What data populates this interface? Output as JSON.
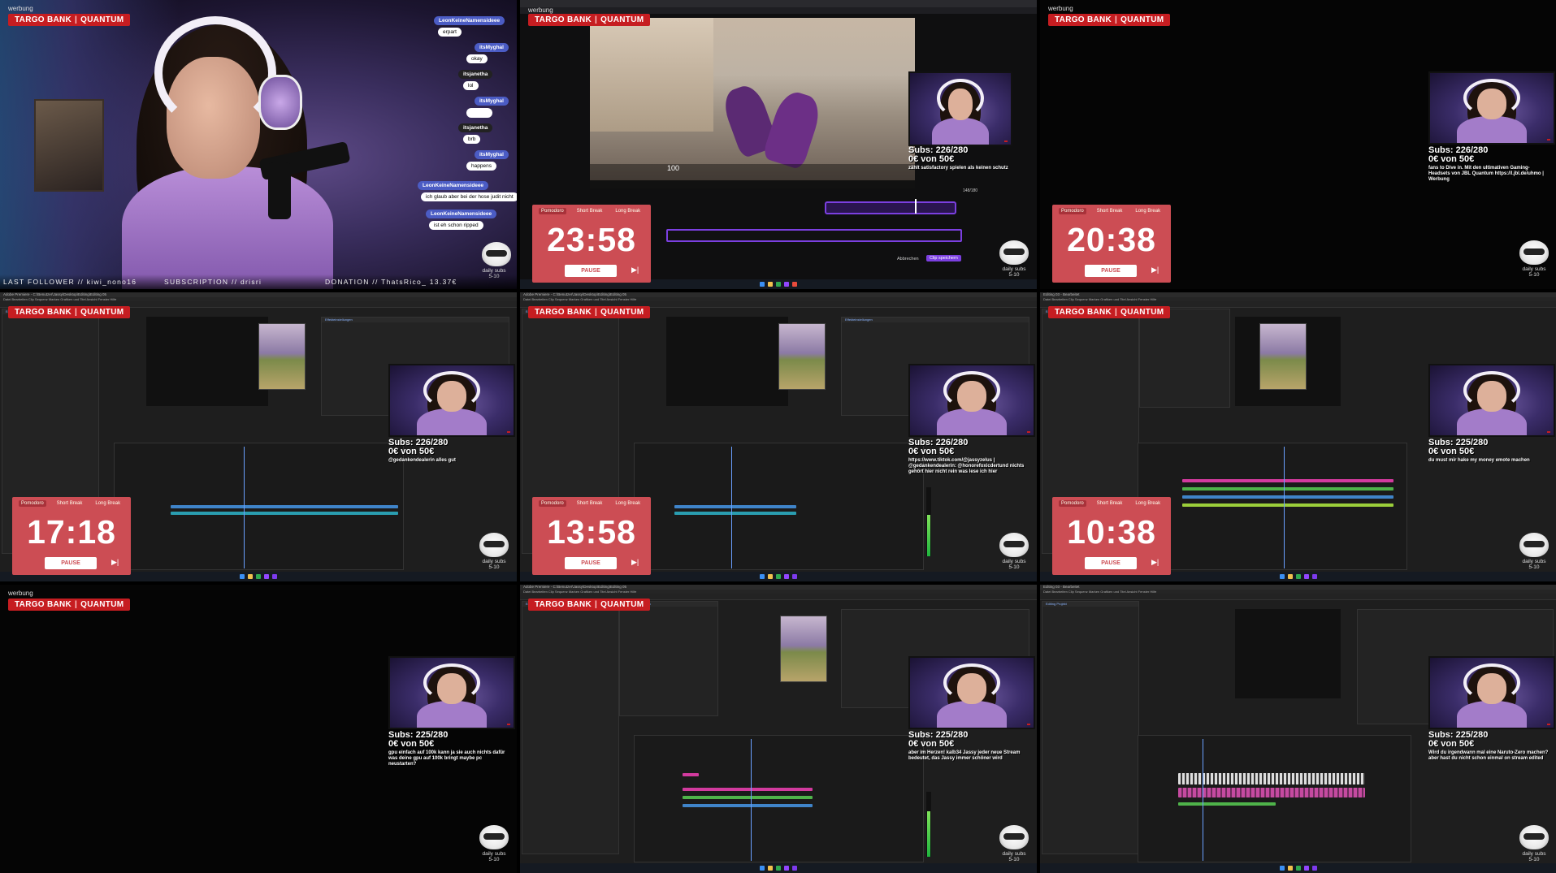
{
  "sponsor": {
    "werbung": "werbung",
    "brand_left": "TARGO BANK",
    "brand_right": "QUANTUM"
  },
  "top_left": {
    "chat": [
      {
        "name": "LeonKeineNamensideee",
        "msg": "erpart"
      },
      {
        "name": "itsMyghal",
        "msg": "okay"
      },
      {
        "name": "itsjanetha",
        "msg": "lol"
      },
      {
        "name": "itsMyghal",
        "msg": ""
      },
      {
        "name": "itsjanetha",
        "msg": "brb"
      },
      {
        "name": "itsMyghal",
        "msg": "happens"
      },
      {
        "name": "LeonKeineNamensideee",
        "msg": "ich glaub aber bei der hose judit nicht"
      },
      {
        "name": "LeonKeineNamensideee",
        "msg": "ist eh schon ripped"
      }
    ],
    "last_follower": "LAST FOLLOWER // kiwi_nono16",
    "subscription": "SUBSCRIPTION // drisri",
    "donation": "DONATION // ThatsRico_ 13.37€"
  },
  "cells": [
    {
      "time": "23:58",
      "subs": "Subs: 226/280",
      "money": "0€ von 50€",
      "chat": "zählt satisfactory spielen als keinen schutz"
    },
    {
      "time": "20:38",
      "subs": "Subs: 226/280",
      "money": "0€ von 50€",
      "chat": "fans to Dive in. Mit den ultimativen Gaming-Headsets von JBL Quantum https://l.jbl.de/uhmo | Werbung"
    },
    {
      "time": "17:18",
      "subs": "Subs: 226/280",
      "money": "0€ von 50€",
      "chat": "@gedankendealerin alles gut"
    },
    {
      "time": "13:58",
      "subs": "Subs: 226/280",
      "money": "0€ von 50€",
      "chat": "https://www.tiktok.com/@jassyzelus | @gedankendealerin: @honorefoxicdertund nichts gehört hier nicht rein was lese ich hier"
    },
    {
      "time": "10:38",
      "subs": "Subs: 225/280",
      "money": "0€ von 50€",
      "chat": "du must mir hake my money emote machen"
    },
    {
      "time": "",
      "subs": "Subs: 225/280",
      "money": "0€ von 50€",
      "chat": "gpu einfach auf 100k kann ja sie auch nichts dafür was deine gpu auf 100k bringt maybe pc neustarten?"
    },
    {
      "time": "",
      "subs": "Subs: 225/280",
      "money": "0€ von 50€",
      "chat": "aber im Herzen! kalb34 Jassy jeder neue Stream bedeutet, das Jassy immer schöner wird"
    },
    {
      "time": "",
      "subs": "Subs: 225/280",
      "money": "0€ von 50€",
      "chat": "Wird du irgendwann mal eine Naruto-Zero machen? aber hast du nicht schon einmal on stream edited"
    }
  ],
  "pomodoro": {
    "tabs": [
      "Pomodoro",
      "Short Break",
      "Long Break"
    ],
    "pause": "PAUSE",
    "skip": "▶|"
  },
  "daily": {
    "line1": "daily subs",
    "line2": "5-10"
  },
  "game": {
    "hp": "100",
    "clip_label": "Clip speichern",
    "cancel_label": "Abbrechen",
    "progress": "148/180"
  },
  "editor": {
    "title_a": "Adobe Premiere - C:\\Benutzer\\Jassy\\Desktop\\Editing\\Editing 05",
    "title_b": "Editing 03 - Bearbeitet",
    "menu": "Datei  Bearbeiten  Clip  Sequenz  Marken  Grafiken und Titel  Ansicht  Fenster  Hilfe",
    "project": "Editing Projekt",
    "effects_tab": "Effekteinstellungen",
    "program": "Programm: NEUES BUNDLE"
  },
  "colors": {
    "accent": "#c61d21",
    "pomo": "#cc4d54",
    "clip": "#7b3fe0"
  }
}
